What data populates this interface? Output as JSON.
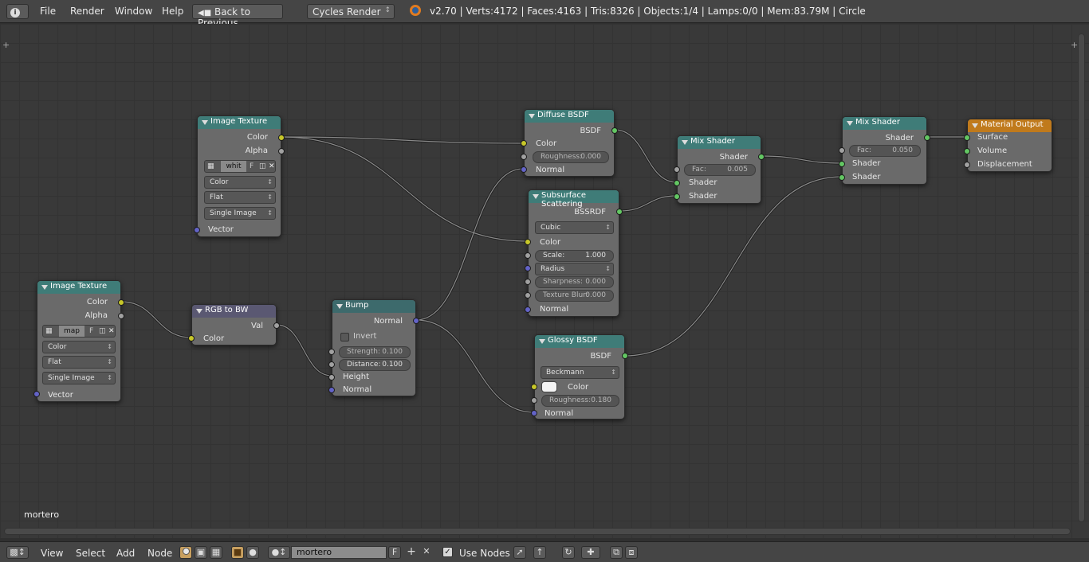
{
  "topbar": {
    "menus": [
      "File",
      "Render",
      "Window",
      "Help"
    ],
    "back_label": "Back to Previous",
    "engine": "Cycles Render",
    "stats": "v2.70 | Verts:4172 | Faces:4163 | Tris:8326 | Objects:1/4 | Lamps:0/0 | Mem:83.79M | Circle"
  },
  "nodes": {
    "img1": {
      "title": "Image Texture",
      "out_color": "Color",
      "out_alpha": "Alpha",
      "image": "whit",
      "f": "F",
      "color_mode": "Color",
      "projection": "Flat",
      "source": "Single Image",
      "in_vector": "Vector"
    },
    "img2": {
      "title": "Image Texture",
      "out_color": "Color",
      "out_alpha": "Alpha",
      "image": "map",
      "f": "F",
      "color_mode": "Color",
      "projection": "Flat",
      "source": "Single Image",
      "in_vector": "Vector"
    },
    "rgb": {
      "title": "RGB to BW",
      "out_val": "Val",
      "in_color": "Color"
    },
    "bump": {
      "title": "Bump",
      "out_normal": "Normal",
      "invert": "Invert",
      "strength_label": "Strength:",
      "strength": "0.100",
      "distance_label": "Distance:",
      "distance": "0.100",
      "in_height": "Height",
      "in_normal": "Normal"
    },
    "diffuse": {
      "title": "Diffuse BSDF",
      "out": "BSDF",
      "in_color": "Color",
      "roughness_label": "Roughness:",
      "roughness": "0.000",
      "in_normal": "Normal"
    },
    "sss": {
      "title": "Subsurface Scattering",
      "out": "BSSRDF",
      "falloff": "Cubic",
      "in_color": "Color",
      "scale_label": "Scale:",
      "scale": "1.000",
      "radius": "Radius",
      "sharpness_label": "Sharpness:",
      "sharpness": "0.000",
      "blur_label": "Texture Blur:",
      "blur": "0.000",
      "in_normal": "Normal"
    },
    "glossy": {
      "title": "Glossy BSDF",
      "out": "BSDF",
      "distribution": "Beckmann",
      "in_color": "Color",
      "roughness_label": "Roughness:",
      "roughness": "0.180",
      "in_normal": "Normal"
    },
    "mix1": {
      "title": "Mix Shader",
      "out": "Shader",
      "fac_label": "Fac:",
      "fac": "0.005",
      "in1": "Shader",
      "in2": "Shader"
    },
    "mix2": {
      "title": "Mix Shader",
      "out": "Shader",
      "fac_label": "Fac:",
      "fac": "0.050",
      "in1": "Shader",
      "in2": "Shader"
    },
    "output": {
      "title": "Material Output",
      "surface": "Surface",
      "volume": "Volume",
      "displacement": "Displacement"
    }
  },
  "material_label": "mortero",
  "bottombar": {
    "menus": [
      "View",
      "Select",
      "Add",
      "Node"
    ],
    "material": "mortero",
    "f": "F",
    "use_nodes": "Use Nodes"
  },
  "colors": {
    "header_bg": "#454545",
    "grid_bg": "#393939",
    "node_body": "#6a6a6a",
    "texture_header": "#3f7c78",
    "converter_header": "#5a5872",
    "output_header": "#c07a1c",
    "color_socket": "#c7c729",
    "shader_socket": "#63c763",
    "vector_socket": "#6363c7",
    "gray_socket": "#a1a1a1"
  }
}
